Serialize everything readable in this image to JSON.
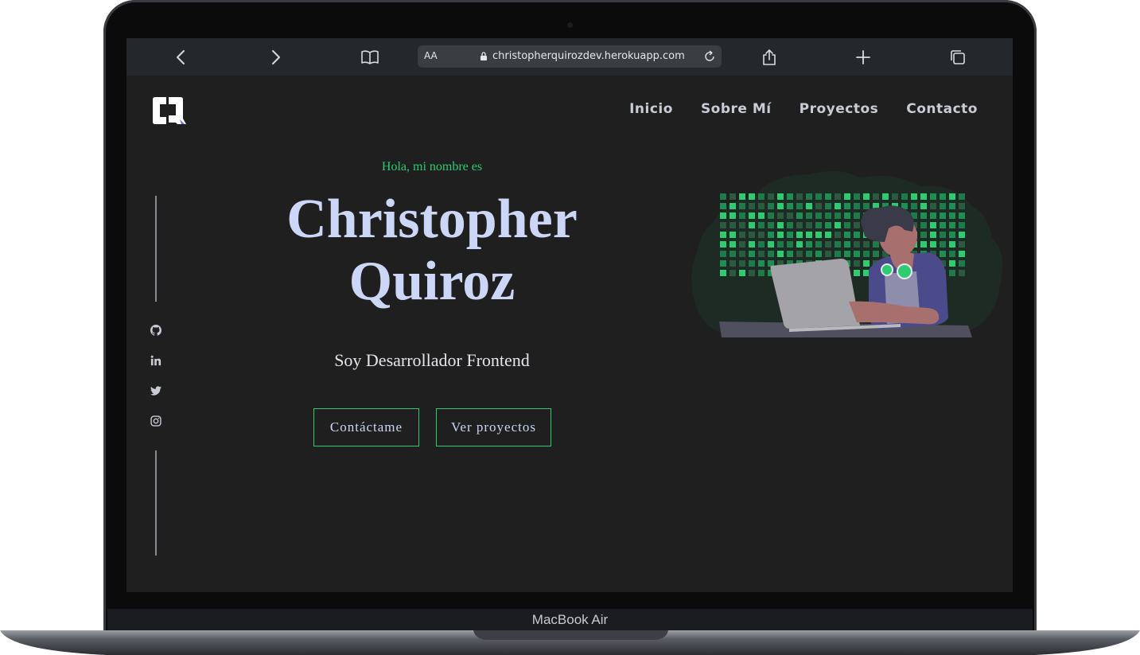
{
  "browser": {
    "url": "christopherquirozdev.herokuapp.com",
    "text_size_label": "AA"
  },
  "nav": {
    "items": [
      "Inicio",
      "Sobre Mí",
      "Proyectos",
      "Contacto"
    ]
  },
  "hero": {
    "greeting": "Hola, mi nombre es",
    "name_line1": "Christopher",
    "name_line2": "Quiroz",
    "tagline": "Soy Desarrollador Frontend",
    "contact_button": "Contáctame",
    "projects_button": "Ver proyectos"
  },
  "social": [
    "github-icon",
    "linkedin-icon",
    "twitter-icon",
    "instagram-icon"
  ],
  "device": {
    "label": "MacBook Air"
  },
  "colors": {
    "accent": "#2ecc71",
    "heading": "#ccd6f6",
    "background": "#1f1f20"
  }
}
